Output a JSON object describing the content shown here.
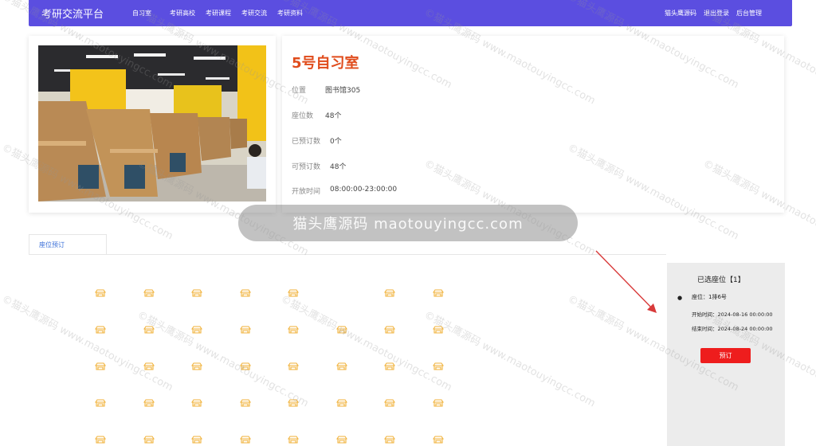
{
  "nav": {
    "brand": "考研交流平台",
    "links": [
      "自习室",
      "考研高校",
      "考研课程",
      "考研交流",
      "考研资料"
    ],
    "right_links": [
      "猫头鹰源码",
      "退出登录",
      "后台管理"
    ]
  },
  "room": {
    "title": "5号自习室",
    "fields": [
      {
        "label": "位置",
        "value": "图书馆305"
      },
      {
        "label": "座位数",
        "value": "48个"
      },
      {
        "label": "已预订数",
        "value": "0个"
      },
      {
        "label": "可预订数",
        "value": "48个"
      },
      {
        "label": "开放时间",
        "value": "08:00:00-23:00:00"
      }
    ]
  },
  "watermark": {
    "pill": "猫头鹰源码 maotouyingcc.com",
    "text": "©猫头鹰源码 www.maotouyingcc.com"
  },
  "tabs": [
    "座位预订"
  ],
  "seats": {
    "icon": "seat-icon",
    "color": "#f0b23a",
    "rows": [
      [
        1,
        1,
        1,
        1,
        1,
        0,
        1,
        1
      ],
      [
        1,
        1,
        1,
        1,
        1,
        1,
        1,
        1
      ],
      [
        1,
        1,
        1,
        1,
        1,
        1,
        1,
        1
      ],
      [
        1,
        1,
        1,
        1,
        1,
        1,
        1,
        1
      ],
      [
        1,
        1,
        1,
        1,
        1,
        1,
        1,
        1
      ]
    ]
  },
  "selection": {
    "title": "已选座位【1】",
    "seat": "座位：1排6号",
    "start": "开始时间：2024-08-16 00:00:00",
    "end": "结束时间：2024-08-24 00:00:00",
    "book_label": "预订"
  },
  "colors": {
    "nav": "#5b4ee0",
    "title": "#e04c1c",
    "button": "#ee1d1d",
    "tab": "#3a6fd8"
  }
}
